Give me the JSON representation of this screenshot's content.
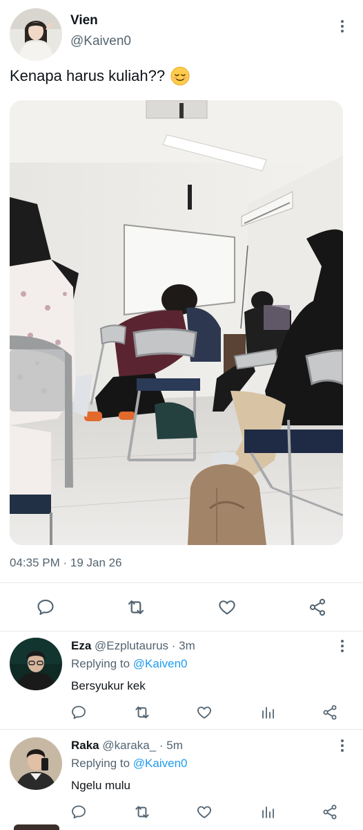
{
  "tweet": {
    "author_name": "Vien",
    "author_handle": "@Kaiven0",
    "text": "Kenapa harus kuliah??",
    "emoji": "relieved-face",
    "timestamp": "04:35 PM · 19 Jan 26",
    "media_alt_subject": "classroom-photo"
  },
  "actions": [
    "reply-icon",
    "retweet-icon",
    "like-icon",
    "share-icon"
  ],
  "replies": [
    {
      "name": "Eza",
      "handle": "@Ezplutaurus",
      "time": "· 3m",
      "replying_prefix": "Replying to",
      "replying_to": "@Kaiven0",
      "text": "Bersyukur kek"
    },
    {
      "name": "Raka",
      "handle": "@karaka_",
      "time": "· 5m",
      "replying_prefix": "Replying to",
      "replying_to": "@Kaiven0",
      "text": "Ngelu mulu"
    }
  ],
  "reply_actions": [
    "reply-icon",
    "retweet-icon",
    "like-icon",
    "analytics-icon",
    "share-icon"
  ],
  "colors": {
    "text": "#0f1419",
    "muted": "#536471",
    "link": "#1d9bf0",
    "divider": "#e7e9ea"
  }
}
